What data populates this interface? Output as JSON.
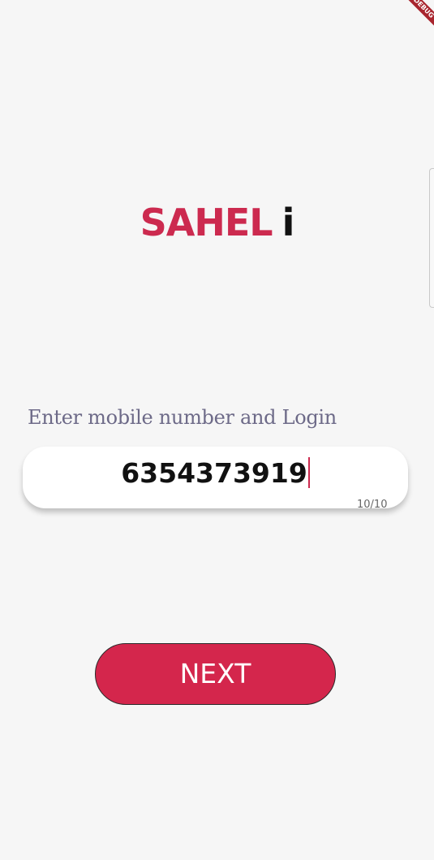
{
  "debug_banner": {
    "label": "DEBUG"
  },
  "logo": {
    "main_text": "SAHEL",
    "tail_text": "i"
  },
  "login": {
    "prompt": "Enter mobile number and Login",
    "phone_value": "6354373919",
    "counter": "10/10",
    "next_label": "NEXT"
  },
  "colors": {
    "background": "#f6f6f6",
    "brand": "#cc2a4f",
    "button": "#d4264c",
    "prompt_text": "#6d6a88"
  }
}
